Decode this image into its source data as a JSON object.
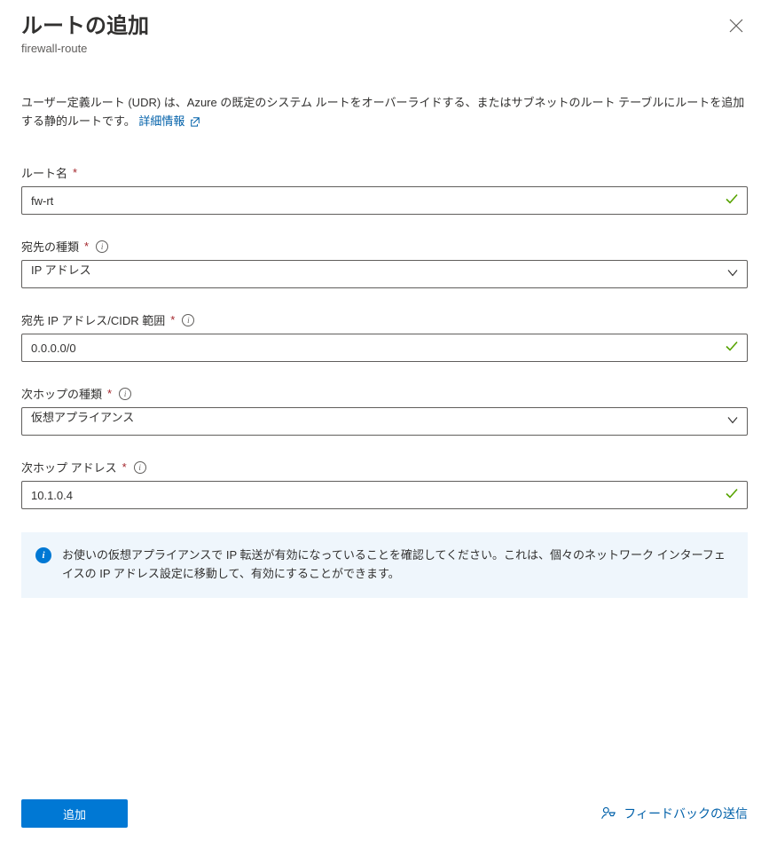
{
  "header": {
    "title": "ルートの追加",
    "subtitle": "firewall-route"
  },
  "description": {
    "text": "ユーザー定義ルート (UDR) は、Azure の既定のシステム ルートをオーバーライドする、またはサブネットのルート テーブルにルートを追加する静的ルートです。",
    "link_label": "詳細情報"
  },
  "fields": {
    "route_name": {
      "label": "ルート名",
      "value": "fw-rt"
    },
    "dest_type": {
      "label": "宛先の種類",
      "value": "IP アドレス"
    },
    "dest_cidr": {
      "label": "宛先 IP アドレス/CIDR 範囲",
      "value": "0.0.0.0/0"
    },
    "next_hop_type": {
      "label": "次ホップの種類",
      "value": "仮想アプライアンス"
    },
    "next_hop_addr": {
      "label": "次ホップ アドレス",
      "value": "10.1.0.4"
    }
  },
  "info_banner": "お使いの仮想アプライアンスで IP 転送が有効になっていることを確認してください。これは、個々のネットワーク インターフェイスの IP アドレス設定に移動して、有効にすることができます。",
  "footer": {
    "primary": "追加",
    "feedback": "フィードバックの送信"
  }
}
